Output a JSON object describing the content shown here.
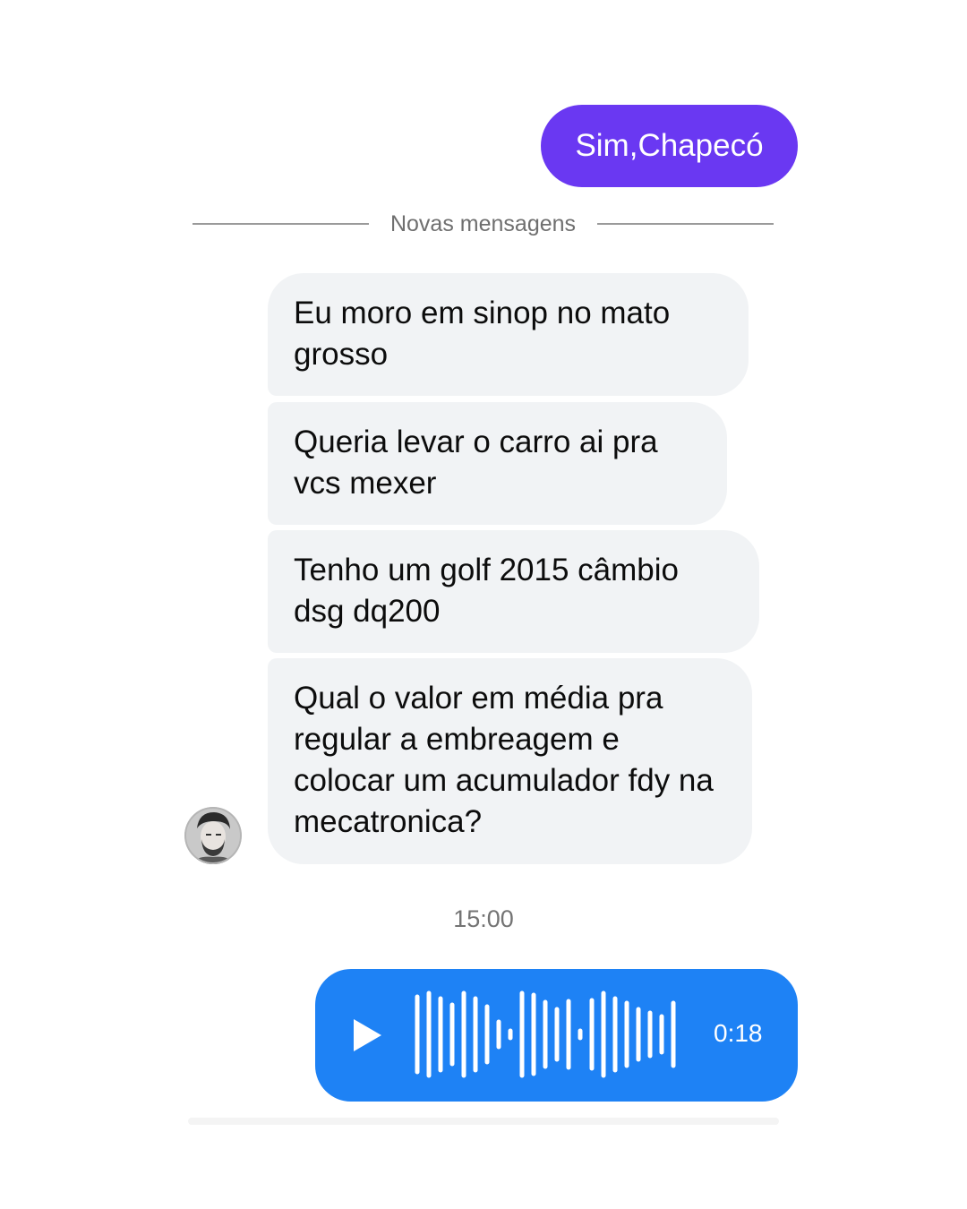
{
  "thread": {
    "sent_message": "Sim,Chapecó",
    "new_messages_divider": "Novas mensagens",
    "received_messages": [
      "Eu moro em sinop  no mato grosso",
      "Queria levar o carro ai pra vcs mexer",
      "Tenho um golf 2015 câmbio dsg dq200",
      "Qual o valor em média pra regular a embreagem e colocar um acumulador fdy na mecatronica?"
    ],
    "timestamp": "15:00",
    "voice_message": {
      "duration": "0:18",
      "play_icon": "play-icon",
      "waveform_icon": "waveform-icon"
    },
    "sender_avatar_icon": "avatar"
  },
  "colors": {
    "sent_bubble": "#6a38f2",
    "received_bubble": "#f1f3f5",
    "voice_bubble": "#1e82f5",
    "divider_text": "#6f6f6f",
    "timestamp_text": "#737373"
  }
}
